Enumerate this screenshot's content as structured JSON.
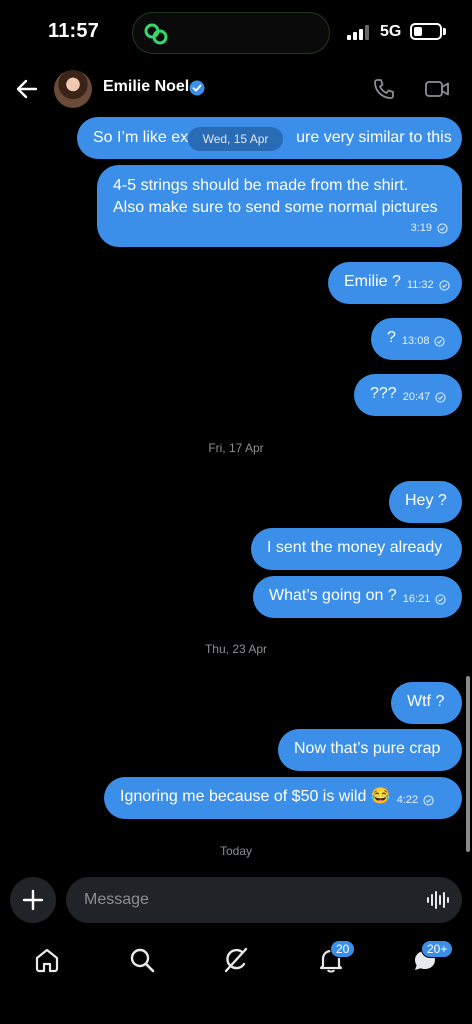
{
  "status_bar": {
    "time": "11:57",
    "network": "5G",
    "battery_level": 0.3,
    "signal_bars": 3
  },
  "header": {
    "contact_name": "Emilie Noel",
    "verified": true,
    "accent_color": "#3b8fe8"
  },
  "messages": [
    {
      "text": "So I’m like ex",
      "text2": "ure very similar to this",
      "time": ""
    },
    {
      "line1": "4-5 strings should be made from the shirt.",
      "line2": "Also make sure to send some normal pictures",
      "time": "3:19"
    },
    {
      "text": "Emilie ?",
      "time": "11:32"
    },
    {
      "text": "?",
      "time": "13:08"
    },
    {
      "text": "???",
      "time": "20:47"
    },
    {
      "text": "Hey ?",
      "time": ""
    },
    {
      "text": "I sent the money already",
      "time": ""
    },
    {
      "text": "What’s going on ?",
      "time": "16:21"
    },
    {
      "text": "Wtf ?",
      "time": ""
    },
    {
      "text": "Now that’s pure crap",
      "time": ""
    },
    {
      "text": "Ignoring me because of $50 is wild 😂",
      "time": "4:22"
    }
  ],
  "date_separators": {
    "floating": "Wed, 15 Apr",
    "fri": "Fri, 17 Apr",
    "thu": "Thu, 23 Apr",
    "today": "Today"
  },
  "composer": {
    "placeholder": "Message"
  },
  "nav": {
    "notifications_badge": "20",
    "messages_badge": "20+"
  }
}
